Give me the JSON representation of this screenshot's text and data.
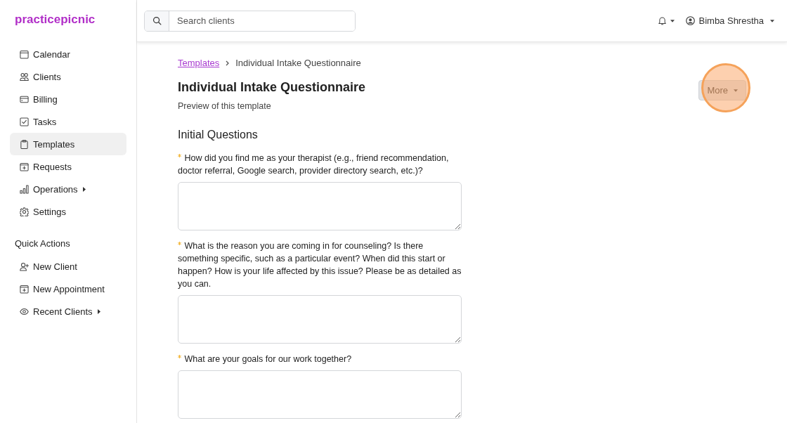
{
  "sidebar": {
    "logo": "practicepicnic",
    "nav_items": [
      {
        "label": "Calendar",
        "selected": false,
        "submenu": false
      },
      {
        "label": "Clients",
        "selected": false,
        "submenu": false
      },
      {
        "label": "Billing",
        "selected": false,
        "submenu": false
      },
      {
        "label": "Tasks",
        "selected": false,
        "submenu": false
      },
      {
        "label": "Templates",
        "selected": true,
        "submenu": false
      },
      {
        "label": "Requests",
        "selected": false,
        "submenu": false
      },
      {
        "label": "Operations",
        "selected": false,
        "submenu": true
      },
      {
        "label": "Settings",
        "selected": false,
        "submenu": false
      }
    ],
    "quick_actions": {
      "heading": "Quick Actions",
      "items": [
        {
          "label": "New Client",
          "submenu": false
        },
        {
          "label": "New Appointment",
          "submenu": false
        },
        {
          "label": "Recent Clients",
          "submenu": true
        }
      ]
    }
  },
  "topbar": {
    "search": {
      "placeholder": "Search clients"
    },
    "user": {
      "name": "Bimba Shrestha"
    }
  },
  "breadcrumb": [
    {
      "label": "Templates",
      "kind": "link"
    },
    {
      "label": "Individual Intake Questionnaire",
      "kind": "current"
    }
  ],
  "page": {
    "title": "Individual Intake Questionnaire",
    "subtitle": "Preview of this template",
    "more_button": {
      "label": "More",
      "highlighted": true
    }
  },
  "section": {
    "heading": "Initial Questions",
    "questions": [
      {
        "label": "How did you find me as your therapist (e.g., friend recommendation, doctor referral, Google search, provider directory search, etc.)?",
        "required": true
      },
      {
        "label": "What is the reason you are coming in for counseling? Is there something specific, such as a particular event? When did this start or happen? How is your life affected by this issue? Please be as detailed as you can.",
        "required": true
      },
      {
        "label": "What are your goals for our work together?",
        "required": true
      }
    ]
  }
}
